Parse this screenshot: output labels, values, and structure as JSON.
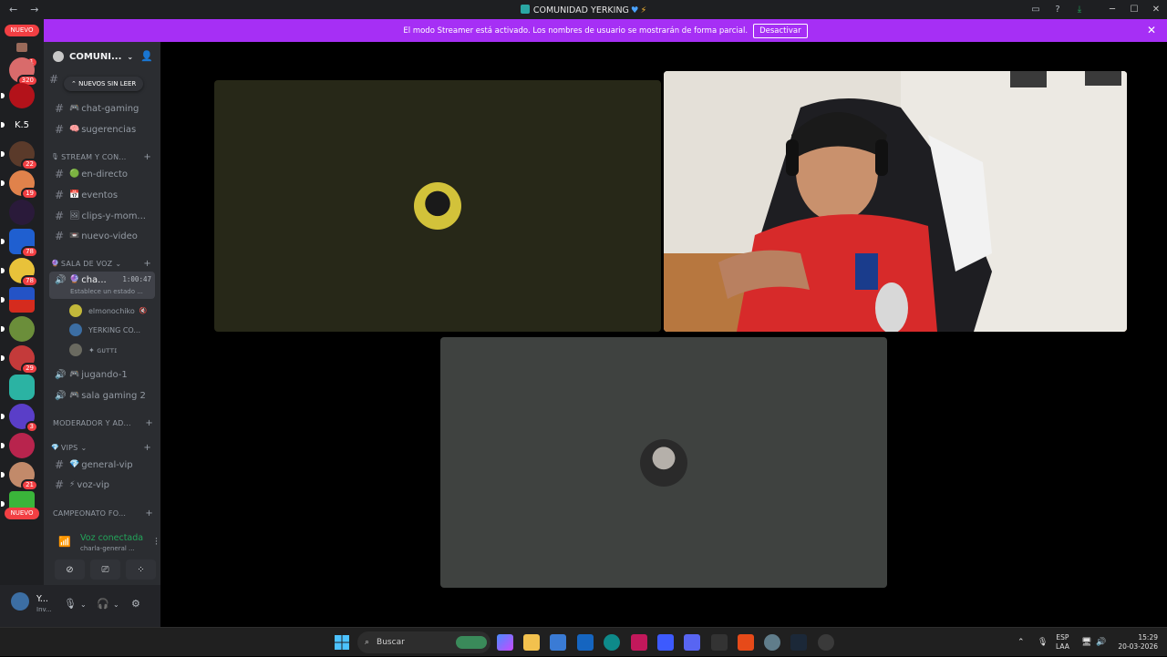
{
  "window": {
    "title": "COMUNIDAD YERKING",
    "nav_back": "←",
    "nav_forward": "→",
    "minimize": "─",
    "maximize": "☐",
    "close": "✕"
  },
  "banner": {
    "text": "El modo Streamer está activado. Los nombres de usuario se mostrarán de forma parcial.",
    "button_label": "Desactivar",
    "close": "✕",
    "color": "#a62ff5"
  },
  "rail": {
    "nuevo_top": "NUEVO",
    "nuevo_bottom": "NUEVO",
    "k5_label": "K.5",
    "badges": [
      "1",
      "320",
      "22",
      "19",
      "78",
      "78",
      "29",
      "3",
      "21"
    ]
  },
  "guild": {
    "name": "COMUNI...",
    "unread_pill": "NUEVOS SIN LEER"
  },
  "channels": {
    "chat_gaming": "chat-gaming",
    "sugerencias": "sugerencias",
    "cat_stream": "STREAM Y CON...",
    "en_directo": "en-directo",
    "eventos": "eventos",
    "clips": "clips-y-mom...",
    "nuevo_video": "nuevo-video",
    "cat_voz": "SALA DE VOZ",
    "charla": "cha...",
    "charla_timer": "1:00:47",
    "charla_status": "Establece un estado ...",
    "user1": "elmonochiko",
    "user2": "YERKING CO...",
    "user3": "✦ ɢᴜᴛᴛɪ",
    "jugando": "jugando-1",
    "sala_gaming": "sala gaming 2",
    "cat_mod": "MODERADOR Y AD...",
    "cat_vips": "VIPS",
    "general_vip": "general-vip",
    "voz_vip": "voz-vip",
    "cat_campeonato": "CAMPEONATO FO..."
  },
  "voice_panel": {
    "title": "Voz conectada",
    "subtitle": "charla-general ..."
  },
  "user": {
    "name": "Y...",
    "sub": "Inv..."
  },
  "taskbar": {
    "search": "Buscar",
    "lang1": "ESP",
    "lang2": "LAA",
    "time": "15:29",
    "date": "20-03-2026"
  }
}
